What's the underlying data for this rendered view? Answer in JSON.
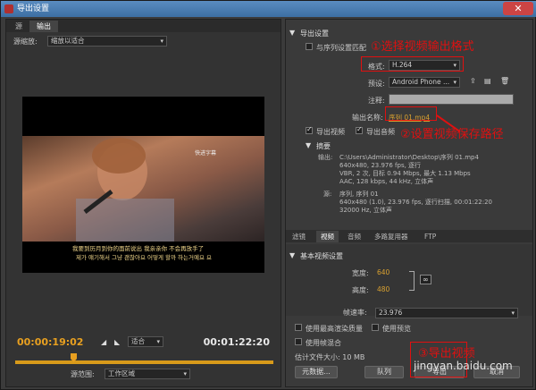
{
  "window": {
    "title": "导出设置",
    "close_label": "✕"
  },
  "left_panel": {
    "tabs": [
      "源",
      "输出"
    ],
    "scale_label": "源缩放:",
    "scale_value": "缩放以适合",
    "video_watermark": "快进字幕",
    "subtitle_line1": "我要到历月到你的面前说出 我亲亲你 不会再放手了",
    "subtitle_line2": "제가 얘기해서 그냥 괜찮아요 어떻게 할까 하는거예요 요",
    "current_time": "00:00:19:02",
    "fit_value": "适合",
    "duration": "00:01:22:20",
    "range_label": "源范围:",
    "range_value": "工作区域"
  },
  "export_settings": {
    "title": "导出设置",
    "match_sequence_label": "与序列设置匹配",
    "format_label": "格式:",
    "format_value": "H.264",
    "preset_label": "预设:",
    "preset_value": "Android Phone ...",
    "comment_label": "注释:",
    "output_name_label": "输出名称:",
    "output_name_value": "序列 01.mp4",
    "export_video_label": "导出视频",
    "export_audio_label": "导出音频"
  },
  "summary": {
    "title": "摘要",
    "output_label": "输出:",
    "output_lines": [
      "C:\\Users\\Administrator\\Desktop\\序列 01.mp4",
      "640x480, 23.976 fps, 逐行",
      "VBR, 2 次, 目标 0.94 Mbps, 最大 1.13 Mbps",
      "AAC, 128 kbps, 44 kHz, 立体声"
    ],
    "source_label": "源:",
    "source_lines": [
      "序列, 序列 01",
      "640x480 (1.0), 23.976 fps, 逐行扫描, 00:01:22:20",
      "32000 Hz, 立体声"
    ]
  },
  "tabs_right": [
    "滤镜",
    "视频",
    "音频",
    "多路复用器",
    "FTP"
  ],
  "basic_video": {
    "title": "基本视频设置",
    "width_label": "宽度:",
    "width_value": "640",
    "height_label": "高度:",
    "height_value": "480",
    "framerate_label": "帧速率:",
    "framerate_value": "23.976"
  },
  "options": {
    "max_render_quality": "使用最高渲染质量",
    "use_preview": "使用预览",
    "use_mix": "使用帧混合",
    "file_size": "估计文件大小: 10 MB"
  },
  "buttons": {
    "metadata": "元数据...",
    "queue": "队列",
    "export": "导出",
    "cancel": "取消"
  },
  "annotations": {
    "step1": "①选择视频输出格式",
    "step2": "②设置视频保存路径",
    "step3": "③导出视频",
    "site": "jingyan.baidu.com"
  }
}
